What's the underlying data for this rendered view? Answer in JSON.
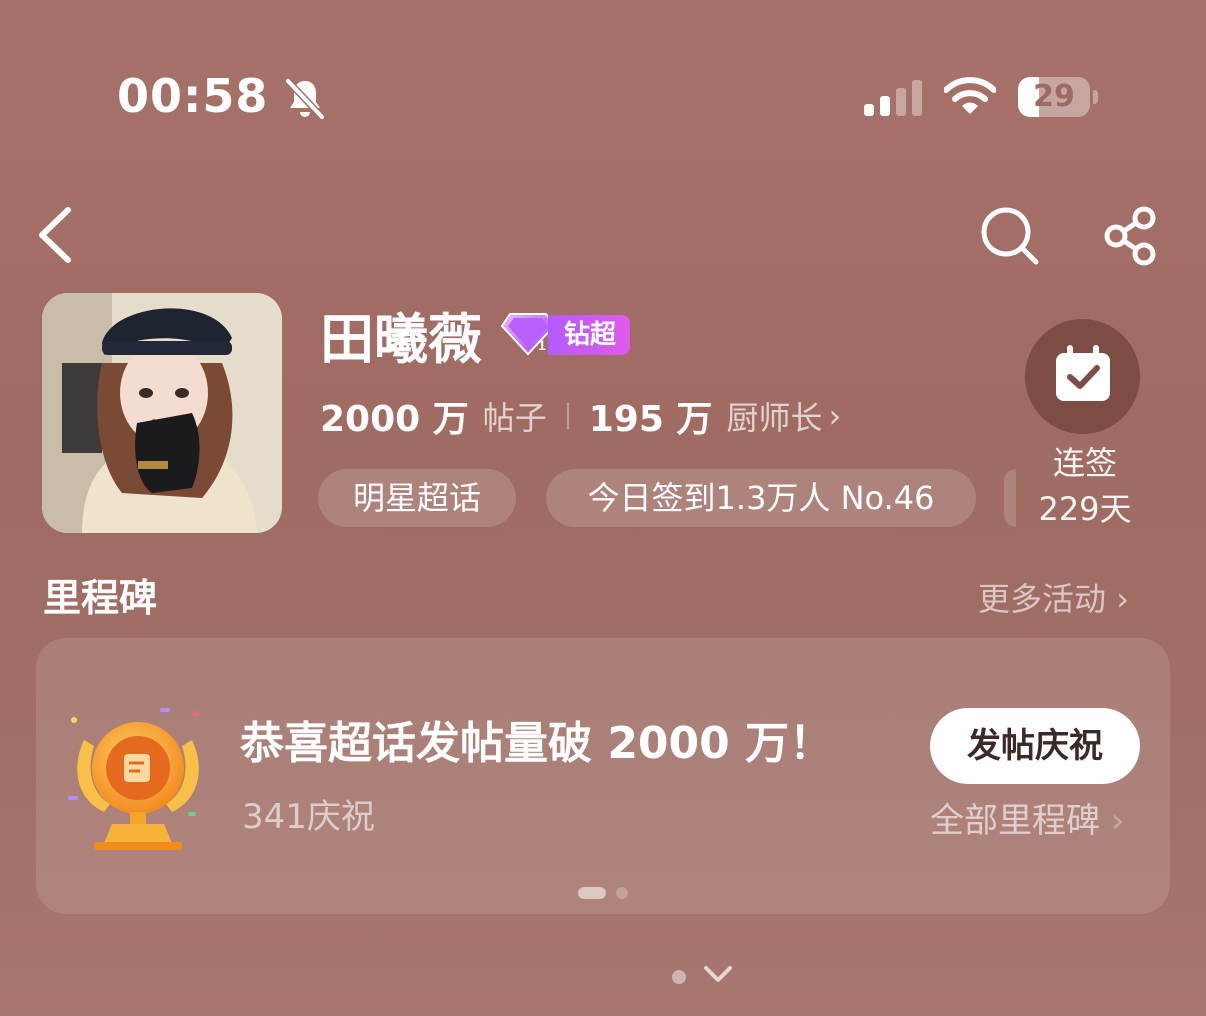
{
  "status_bar": {
    "time": "00:58",
    "battery": "29",
    "battery_level": 0.29
  },
  "nav": {
    "back_icon": "chevron-left-icon",
    "search_icon": "search-icon",
    "share_icon": "share-icon"
  },
  "profile": {
    "name": "田曦薇",
    "badge": "钻超",
    "posts_count": "2000 万",
    "posts_label": "帖子",
    "fans_count": "195 万",
    "fans_label": "厨师长",
    "tags": [
      "明星超话",
      "今日签到1.3万人 No.46"
    ],
    "checkin_label": "连签",
    "checkin_days": "229天"
  },
  "milestone": {
    "section_title": "里程碑",
    "more_label": "更多活动",
    "title": "恭喜超话发帖量破 2000 万！",
    "celebrations": "341庆祝",
    "action_button": "发帖庆祝",
    "all_label": "全部里程碑"
  },
  "colors": {
    "background": "#a06f67",
    "checkin_bg": "#7d4c45",
    "badge_gradient_start": "#b45bff",
    "badge_gradient_end": "#e05bea",
    "trophy_gold": "#f6a623"
  }
}
